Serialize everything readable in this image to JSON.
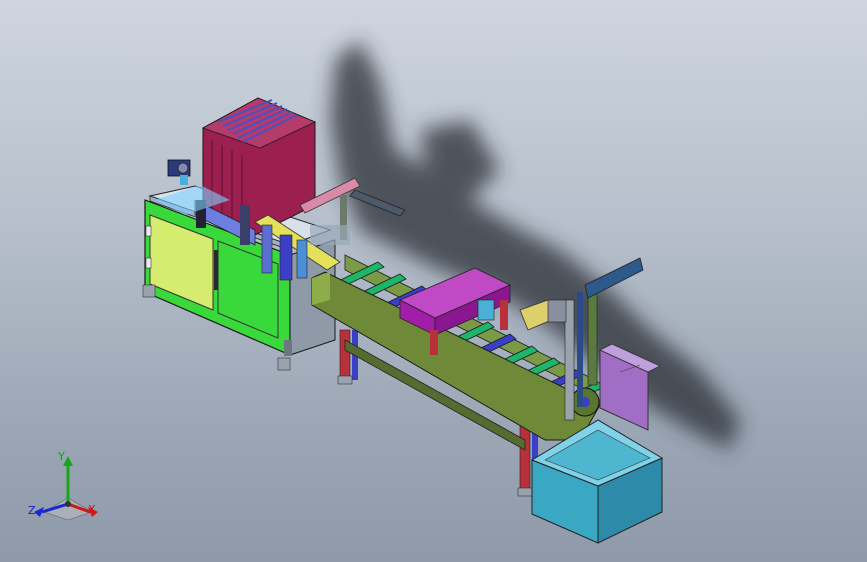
{
  "viewport": {
    "background_top": "#cfd5de",
    "background_bottom": "#8e99a9"
  },
  "model": {
    "colors": {
      "cabinet_frame": "#39d93b",
      "cabinet_door": "#d6ec6e",
      "magazine": "#9b1f4f",
      "conveyor_side": "#6e8a38",
      "rollers": "#1db56a",
      "slats": "#3a3fc8",
      "press_block": "#a31ea8",
      "bin_purple": "#a06ec4",
      "bin_cyan": "#3aa8c2",
      "leg_red": "#b8303a",
      "shadow": "#2c2f35"
    }
  },
  "triad": {
    "x_label": "X",
    "y_label": "Y",
    "z_label": "Z"
  }
}
